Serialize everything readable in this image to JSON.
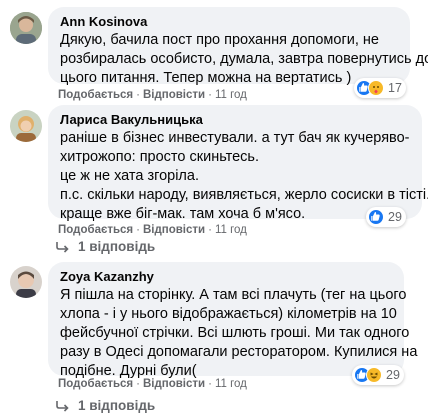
{
  "comments": [
    {
      "author": "Ann Kosinova",
      "lines": [
        "Дякую, бачила пост про прохання допомоги, не",
        "розбиралась особисто, думала, завтра повернутись до",
        "цього питання. Тепер можна на вертатись )"
      ],
      "like_label": "Подобається",
      "reply_label": "Відповісти",
      "time": "11 год",
      "reaction_count": "17",
      "reactions": [
        "like-icon",
        "care-icon"
      ]
    },
    {
      "author": "Лариса Вакульницька",
      "lines": [
        "раніше в бізнес инвестували. а тут бач як кучеряво-",
        "хитрожопо: просто скиньтесь.",
        "це ж не хата згоріла.",
        "п.с. скільки народу, виявляється, жерло сосиски в тісті.",
        "краще вже біг-мак. там хоча б м'ясо."
      ],
      "like_label": "Подобається",
      "reply_label": "Відповісти",
      "time": "11 год",
      "reaction_count": "29",
      "reactions": [
        "like-icon"
      ],
      "replies_label": "1 відповідь"
    },
    {
      "author": "Zoya Kazanzhy",
      "lines": [
        "Я пішла на сторінку. А там всі плачуть (тег на цього",
        "хлопа - і у нього відображається) кілометрів на 10",
        "фейсбучної стрічки. Всі шлють гроші. Ми так одного",
        "разу в Одесі допомагали ресторатором. Купилися на",
        "подібне. Дурні були("
      ],
      "like_label": "Подобається",
      "reply_label": "Відповісти",
      "time": "11 год",
      "reaction_count": "29",
      "reactions": [
        "like-icon",
        "haha-icon"
      ],
      "replies_label": "1 відповідь"
    }
  ],
  "colors": {
    "bubble": "#f0f2f5",
    "meta": "#65676b",
    "like": "#1877f2",
    "emoji": "#f7b928"
  }
}
